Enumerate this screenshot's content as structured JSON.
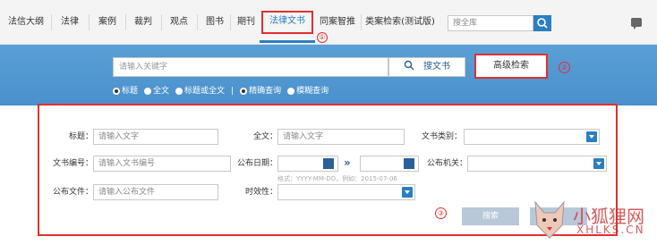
{
  "nav": {
    "items": [
      "法信大纲",
      "法律",
      "案例",
      "裁判",
      "观点",
      "图书",
      "期刊",
      "法律文书",
      "同案智推",
      "类案检索(测试版)"
    ],
    "active_index": 7,
    "search_placeholder": "搜全库"
  },
  "search": {
    "keyword_placeholder": "请输入关键字",
    "search_button": "搜文书",
    "advanced_button": "高级检索",
    "options": [
      {
        "label": "标题",
        "checked": true
      },
      {
        "label": "全文",
        "checked": false
      },
      {
        "label": "标题或全文",
        "checked": false
      },
      {
        "label": "精确查询",
        "checked": true
      },
      {
        "label": "模糊查询",
        "checked": false
      }
    ],
    "divider": "|"
  },
  "advanced": {
    "title_label": "标题：",
    "title_placeholder": "请输入文字",
    "fulltext_label": "全文：",
    "fulltext_placeholder": "请输入文字",
    "doctype_label": "文书类别：",
    "docno_label": "文书编号：",
    "docno_placeholder": "请输入文书编号",
    "pubdate_label": "公布日期：",
    "date_hint": "格式：YYYY-MM-DD，例如：2015-07-06",
    "pubauth_label": "公布机关：",
    "pubfile_label": "公布文件：",
    "pubfile_placeholder": "请输入公布文件",
    "validity_label": "时效性：",
    "search_button": "搜索",
    "reset_button": "清空"
  },
  "markers": [
    "①",
    "②",
    "③"
  ],
  "watermark": {
    "cn": "小狐狸网",
    "en": "XHLKS.CN"
  },
  "colors": {
    "accent": "#2a7fc1",
    "band": "#4a90cc",
    "highlight": "#e03030"
  }
}
